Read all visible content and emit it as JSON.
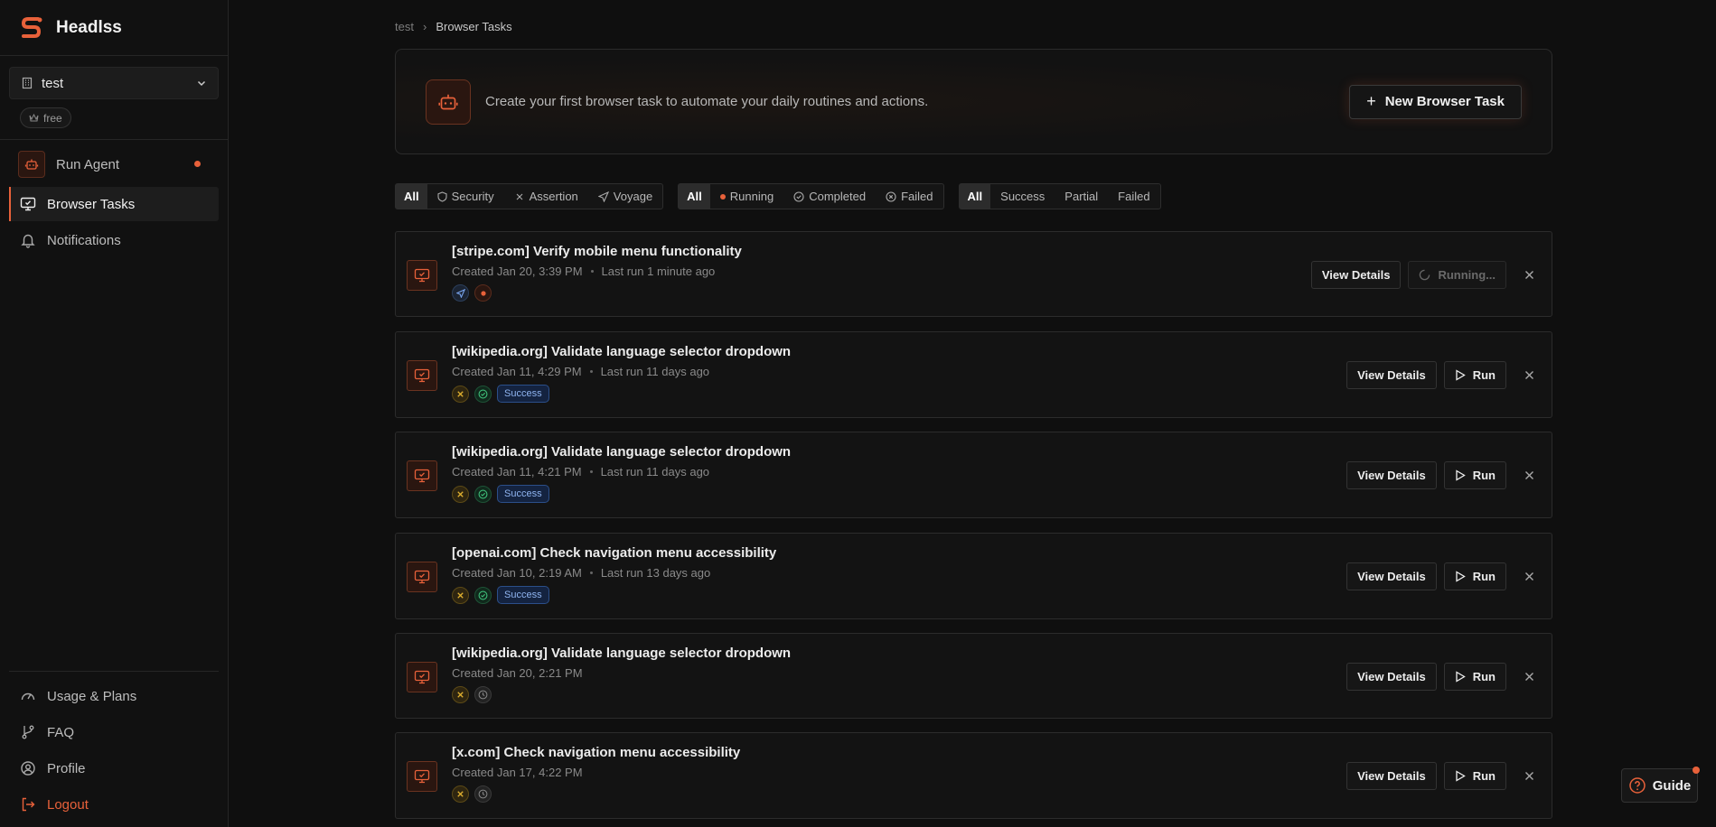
{
  "app": {
    "name": "Headlss",
    "accent": "#e8613a"
  },
  "workspace": {
    "name": "test",
    "plan": "free"
  },
  "nav": {
    "run_agent": "Run Agent",
    "browser_tasks": "Browser Tasks",
    "notifications": "Notifications"
  },
  "bottom_nav": {
    "usage": "Usage & Plans",
    "faq": "FAQ",
    "profile": "Profile",
    "logout": "Logout"
  },
  "breadcrumb": {
    "root": "test",
    "current": "Browser Tasks"
  },
  "hero": {
    "text": "Create your first browser task to automate your daily routines and actions.",
    "button": "New Browser Task"
  },
  "filters": {
    "type": [
      "All",
      "Security",
      "Assertion",
      "Voyage"
    ],
    "status": [
      "All",
      "Running",
      "Completed",
      "Failed"
    ],
    "result": [
      "All",
      "Success",
      "Partial",
      "Failed"
    ]
  },
  "labels": {
    "view_details": "View Details",
    "run": "Run",
    "running": "Running...",
    "guide": "Guide"
  },
  "tasks": [
    {
      "title": "[stripe.com] Verify mobile menu functionality",
      "created": "Created Jan 20, 3:39 PM",
      "last_run": "Last run 1 minute ago",
      "tags": [
        "voyage-icon",
        "running-icon"
      ],
      "badge": "",
      "state": "running"
    },
    {
      "title": "[wikipedia.org] Validate language selector dropdown",
      "created": "Created Jan 11, 4:29 PM",
      "last_run": "Last run 11 days ago",
      "tags": [
        "assertion-icon",
        "completed-icon"
      ],
      "badge": "Success",
      "state": "idle"
    },
    {
      "title": "[wikipedia.org] Validate language selector dropdown",
      "created": "Created Jan 11, 4:21 PM",
      "last_run": "Last run 11 days ago",
      "tags": [
        "assertion-icon",
        "completed-icon"
      ],
      "badge": "Success",
      "state": "idle"
    },
    {
      "title": "[openai.com] Check navigation menu accessibility",
      "created": "Created Jan 10, 2:19 AM",
      "last_run": "Last run 13 days ago",
      "tags": [
        "assertion-icon",
        "completed-icon"
      ],
      "badge": "Success",
      "state": "idle"
    },
    {
      "title": "[wikipedia.org] Validate language selector dropdown",
      "created": "Created Jan 20, 2:21 PM",
      "last_run": "",
      "tags": [
        "assertion-icon",
        "clock-icon"
      ],
      "badge": "",
      "state": "idle"
    },
    {
      "title": "[x.com] Check navigation menu accessibility",
      "created": "Created Jan 17, 4:22 PM",
      "last_run": "",
      "tags": [
        "assertion-icon",
        "clock-icon"
      ],
      "badge": "",
      "state": "idle"
    }
  ]
}
